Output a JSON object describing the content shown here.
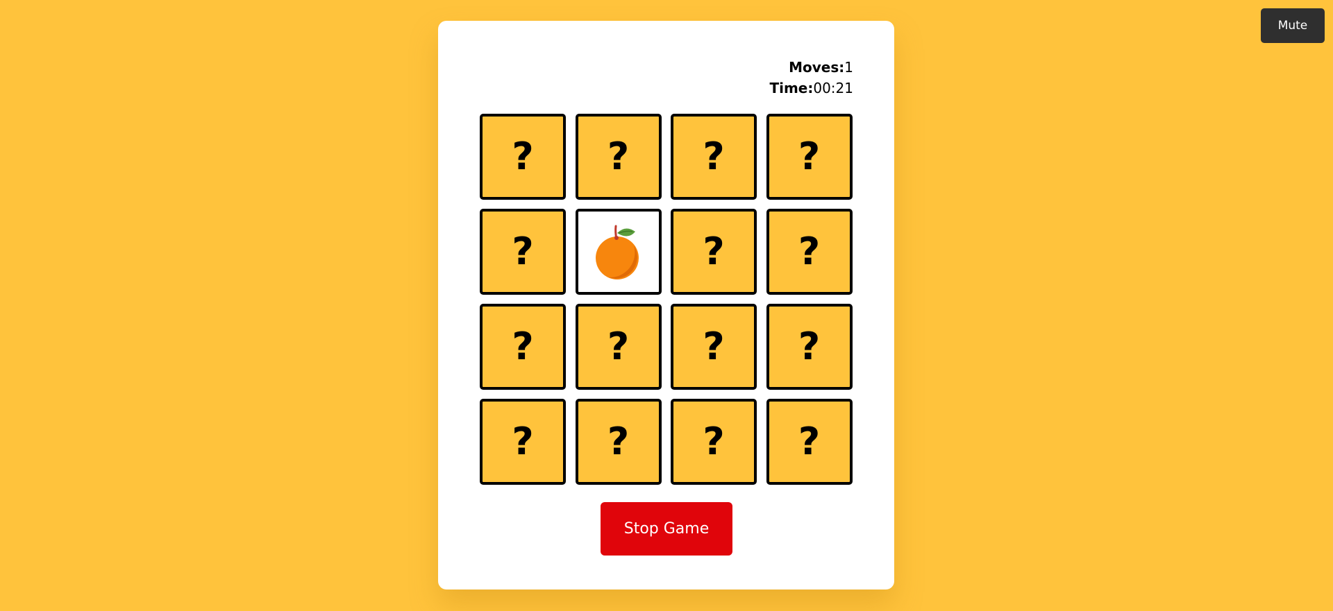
{
  "header": {
    "mute_label": "Mute"
  },
  "stats": {
    "moves_label": "Moves:",
    "moves_value": "1",
    "time_label": "Time:",
    "time_value": "00:21"
  },
  "board": {
    "hidden_symbol": "?",
    "cards": [
      {
        "state": "hidden",
        "face": ""
      },
      {
        "state": "hidden",
        "face": ""
      },
      {
        "state": "hidden",
        "face": ""
      },
      {
        "state": "hidden",
        "face": ""
      },
      {
        "state": "hidden",
        "face": ""
      },
      {
        "state": "revealed",
        "face": "orange-icon"
      },
      {
        "state": "hidden",
        "face": ""
      },
      {
        "state": "hidden",
        "face": ""
      },
      {
        "state": "hidden",
        "face": ""
      },
      {
        "state": "hidden",
        "face": ""
      },
      {
        "state": "hidden",
        "face": ""
      },
      {
        "state": "hidden",
        "face": ""
      },
      {
        "state": "hidden",
        "face": ""
      },
      {
        "state": "hidden",
        "face": ""
      },
      {
        "state": "hidden",
        "face": ""
      },
      {
        "state": "hidden",
        "face": ""
      }
    ]
  },
  "controls": {
    "stop_label": "Stop Game"
  },
  "colors": {
    "background": "#ffc33c",
    "card_back": "#ffc33c",
    "card_border": "#000000",
    "stop_button": "#e0050b",
    "mute_button": "#2f2f2f",
    "orange": "#f7860d"
  }
}
